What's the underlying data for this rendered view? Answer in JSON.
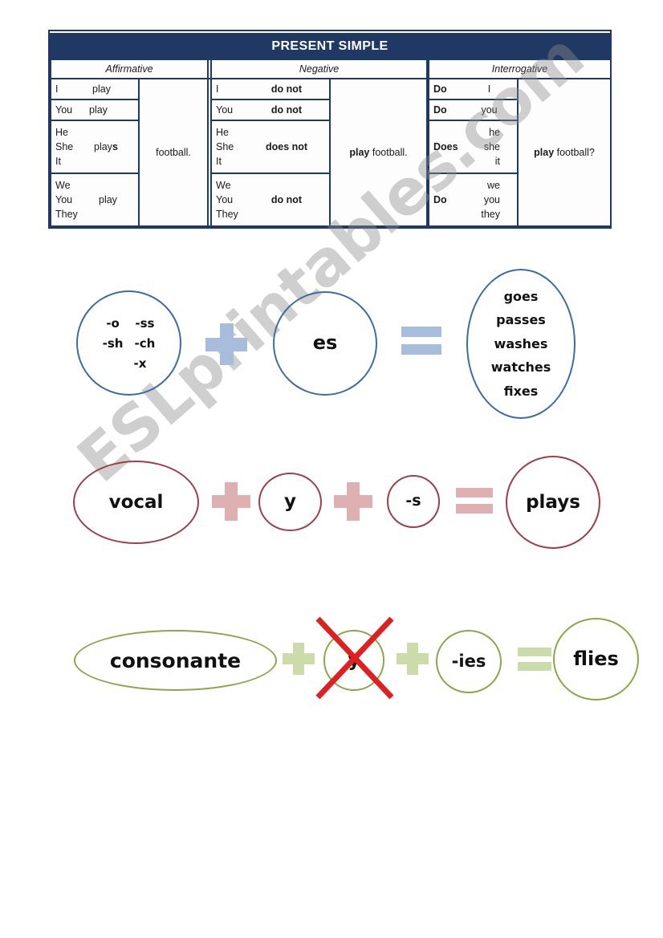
{
  "document": {
    "watermark": "ESLprintables.com"
  },
  "table": {
    "title": "PRESENT SIMPLE",
    "headers": [
      "Affirmative",
      "Negative",
      "Interrogative"
    ],
    "affirmative": {
      "rows": [
        {
          "subjects": [
            "I"
          ],
          "verb": "play"
        },
        {
          "subjects": [
            "You"
          ],
          "verb": "play"
        },
        {
          "subjects": [
            "He",
            "She",
            "It"
          ],
          "verb": "plays",
          "verb_stem": "play",
          "verb_suffix": "s"
        },
        {
          "subjects": [
            "We",
            "You",
            "They"
          ],
          "verb": "play"
        }
      ],
      "complement": "football."
    },
    "negative": {
      "rows": [
        {
          "subjects": [
            "I"
          ],
          "aux": "do not"
        },
        {
          "subjects": [
            "You"
          ],
          "aux": "do not"
        },
        {
          "subjects": [
            "He",
            "She",
            "It"
          ],
          "aux": "does not"
        },
        {
          "subjects": [
            "We",
            "You",
            "They"
          ],
          "aux": "do not"
        }
      ],
      "complement_bold": "play",
      "complement_rest": " football."
    },
    "interrogative": {
      "rows": [
        {
          "aux": "Do",
          "subjects": [
            "I"
          ]
        },
        {
          "aux": "Do",
          "subjects": [
            "you"
          ]
        },
        {
          "aux": "Does",
          "subjects": [
            "he",
            "she",
            "it"
          ]
        },
        {
          "aux": "Do",
          "subjects": [
            "we",
            "you",
            "they"
          ]
        }
      ],
      "complement_bold": "play",
      "complement_rest": " football?"
    }
  },
  "rules": {
    "blue": {
      "color": "#3d6ca3",
      "op_color": "#a8bcdb",
      "endings": [
        "-o",
        "-ss",
        "-sh",
        "-ch",
        "-x"
      ],
      "suffix": "es",
      "plus": "+",
      "equals": "=",
      "examples": [
        "goes",
        "passes",
        "washes",
        "watches",
        "fixes"
      ]
    },
    "red": {
      "color": "#9e3f4a",
      "op_color": "#dfb0b2",
      "first": "vocal",
      "letter": "y",
      "suffix": "-s",
      "result": "plays",
      "plus": "+",
      "equals": "="
    },
    "green": {
      "color": "#8aa84b",
      "op_color": "#cddbaa",
      "cross_color": "#e02020",
      "first": "consonante",
      "letter": "y",
      "suffix": "-ies",
      "result": "flies",
      "plus": "+",
      "equals": "="
    }
  }
}
